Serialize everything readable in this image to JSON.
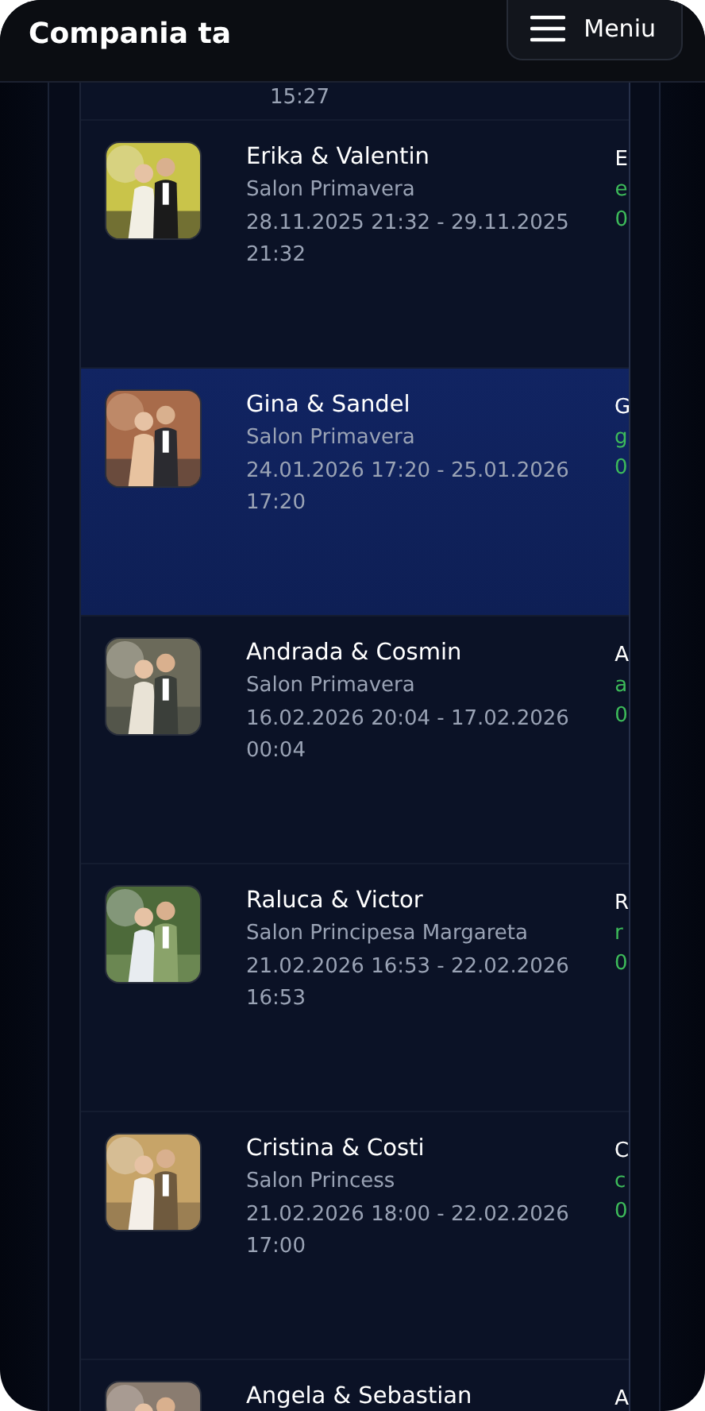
{
  "header": {
    "title": "Compania ta",
    "menu_button": "Meniu"
  },
  "partial_row": {
    "dates_tail": "15:27"
  },
  "events": [
    {
      "name": "Erika & Valentin",
      "venue": "Salon Primavera",
      "dates": "28.11.2025 21:32  - 29.11.2025 21:32",
      "selected": false,
      "column_2": [
        "E",
        "e",
        "0"
      ]
    },
    {
      "name": "Gina & Sandel",
      "venue": "Salon Primavera",
      "dates": "24.01.2026 17:20  - 25.01.2026 17:20",
      "selected": true,
      "column_2": [
        "G",
        "g",
        "0"
      ]
    },
    {
      "name": "Andrada & Cosmin",
      "venue": "Salon Primavera",
      "dates": "16.02.2026 20:04  - 17.02.2026 00:04",
      "selected": false,
      "column_2": [
        "A",
        "a",
        "0"
      ]
    },
    {
      "name": "Raluca & Victor",
      "venue": "Salon Principesa Margareta",
      "dates": "21.02.2026 16:53  - 22.02.2026 16:53",
      "selected": false,
      "column_2": [
        "R",
        "r",
        "0"
      ]
    },
    {
      "name": "Cristina & Costi",
      "venue": "Salon Princess",
      "dates": "21.02.2026 18:00  - 22.02.2026 17:00",
      "selected": false,
      "column_2": [
        "C",
        "c",
        "0"
      ]
    },
    {
      "name": "Angela & Sebastian",
      "selected": false,
      "column_2": [
        "A"
      ]
    }
  ]
}
